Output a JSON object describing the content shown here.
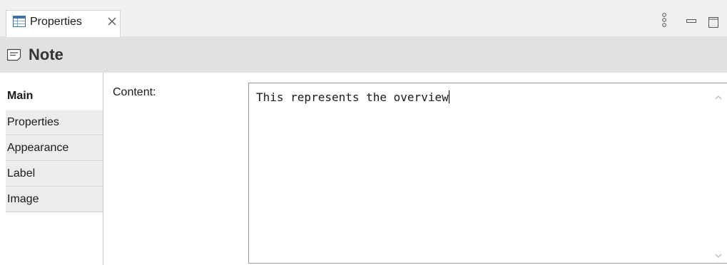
{
  "view": {
    "tab_label": "Properties",
    "tab_icon": "properties-table-icon",
    "close_icon": "close-icon",
    "toolbar_icons": [
      "view-menu-icon",
      "minimize-icon",
      "maximize-icon"
    ]
  },
  "header": {
    "icon": "note-icon",
    "title": "Note"
  },
  "sections": {
    "items": [
      {
        "label": "Main",
        "active": true
      },
      {
        "label": "Properties",
        "active": false
      },
      {
        "label": "Appearance",
        "active": false
      },
      {
        "label": "Label",
        "active": false
      },
      {
        "label": "Image",
        "active": false
      }
    ]
  },
  "main": {
    "content_label": "Content:",
    "content_value": "This represents the overview"
  },
  "colors": {
    "tabstrip_bg": "#f0f0f0",
    "titlebar_bg": "#e1e1e1",
    "inactive_section_bg": "#ececec"
  }
}
